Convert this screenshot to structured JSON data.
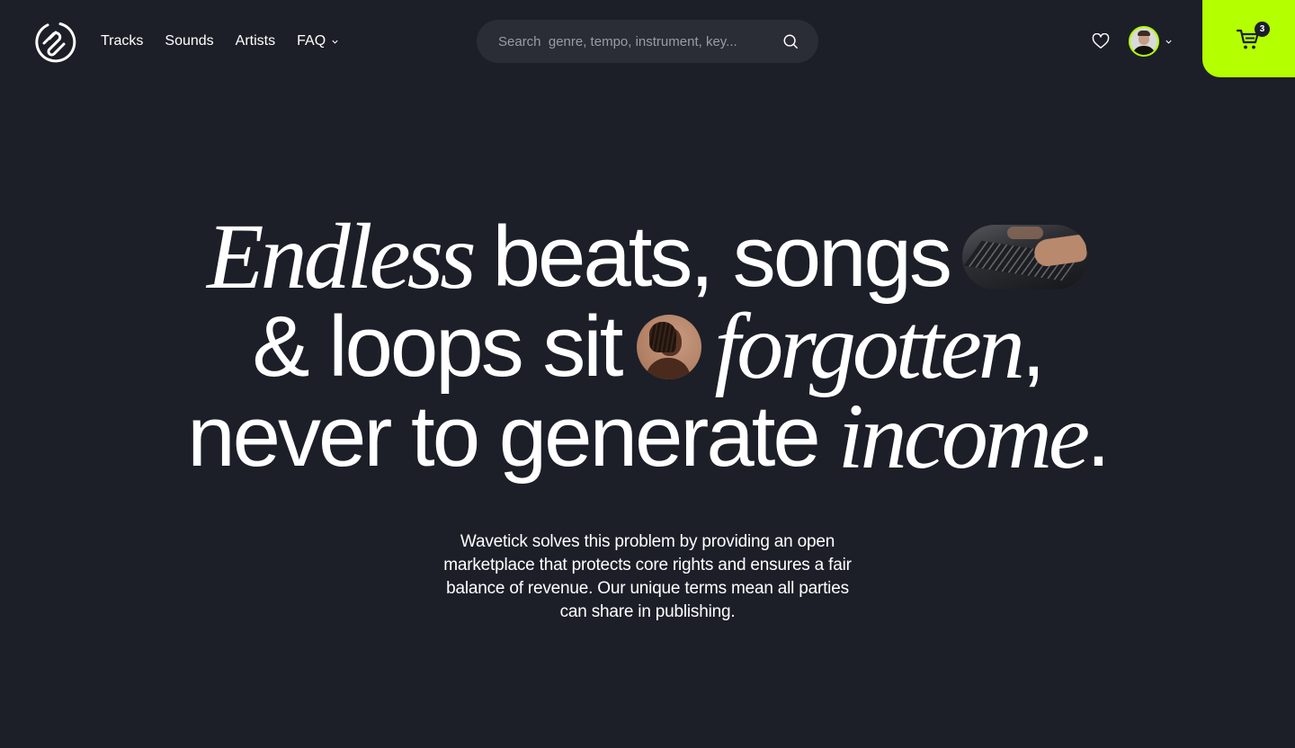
{
  "brand": {
    "logo_icon": "paperclip-wave-logo-icon",
    "accent_color": "#b4ff00",
    "background_color": "#1c1f28"
  },
  "nav": {
    "items": [
      {
        "label": "Tracks"
      },
      {
        "label": "Sounds"
      },
      {
        "label": "Artists"
      },
      {
        "label": "FAQ",
        "has_dropdown": true
      }
    ]
  },
  "search": {
    "placeholder": "Search  genre, tempo, instrument, key...",
    "value": "",
    "icon": "search-icon"
  },
  "user_actions": {
    "favorites_icon": "heart-icon",
    "avatar_icon": "user-avatar",
    "avatar_dropdown_icon": "chevron-down-icon",
    "cart_icon": "shopping-cart-icon",
    "cart_count": "3"
  },
  "hero": {
    "line1": {
      "italic": "Endless",
      "rest": "beats, songs",
      "image": "mixing-console-hands-photo"
    },
    "line2": {
      "lead": "& loops sit",
      "image": "artist-portrait-photo",
      "italic": "forgotten",
      "trail": ","
    },
    "line3": {
      "lead": "never to generate",
      "italic": "income",
      "trail": "."
    },
    "subtext": "Wavetick solves this problem by providing an open marketplace that protects core rights and ensures a fair balance of revenue. Our unique terms mean all parties can share in publishing."
  }
}
